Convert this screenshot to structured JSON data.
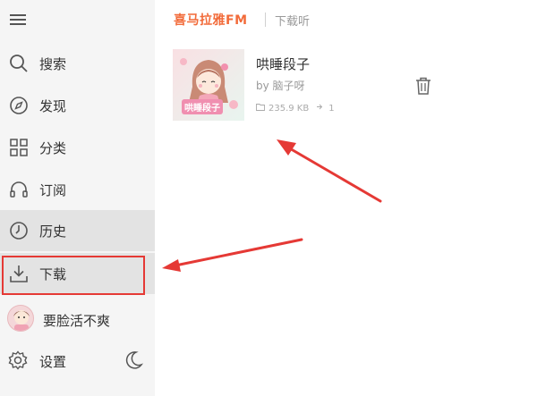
{
  "sidebar": {
    "nav": [
      {
        "label": "搜索",
        "icon": "search-icon"
      },
      {
        "label": "发现",
        "icon": "compass-icon"
      },
      {
        "label": "分类",
        "icon": "grid-icon"
      },
      {
        "label": "订阅",
        "icon": "headphones-icon"
      },
      {
        "label": "历史",
        "icon": "clock-icon"
      },
      {
        "label": "下载",
        "icon": "download-icon"
      }
    ],
    "user": {
      "name": "要脸活不爽"
    },
    "settings": {
      "label": "设置"
    }
  },
  "header": {
    "logo": "喜马拉雅FM",
    "title": "下载听"
  },
  "album": {
    "title": "哄睡段子",
    "author": "by 脑子呀",
    "size": "235.9 KB",
    "count": "1",
    "cover_text": "哄睡段子"
  },
  "colors": {
    "accent": "#f26b3a",
    "annotation": "#e53935",
    "sidebar_bg": "#f5f5f5"
  }
}
